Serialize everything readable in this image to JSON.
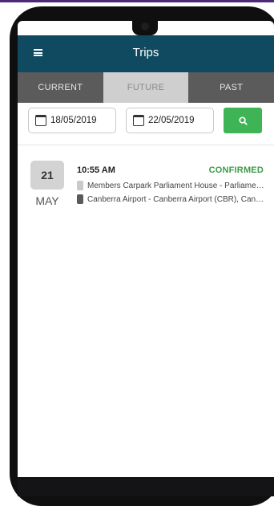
{
  "app": {
    "title": "Trips"
  },
  "tabs": [
    {
      "label": "CURRENT",
      "active": false
    },
    {
      "label": "FUTURE",
      "active": true
    },
    {
      "label": "PAST",
      "active": false
    }
  ],
  "filters": {
    "from_date": "18/05/2019",
    "to_date": "22/05/2019",
    "search_icon": "search-icon"
  },
  "trips": [
    {
      "day": "21",
      "month": "MAY",
      "time": "10:55 AM",
      "status": "CONFIRMED",
      "pickup": "Members Carpark Parliament House - Parliament House",
      "dropoff": "Canberra Airport - Canberra Airport (CBR), Canberra"
    }
  ],
  "colors": {
    "appbar": "#0f4a60",
    "tab_inactive": "#5b5b5b",
    "tab_active": "#cfcfcf",
    "search_button": "#3fb456",
    "status_confirmed": "#3e9a49"
  }
}
